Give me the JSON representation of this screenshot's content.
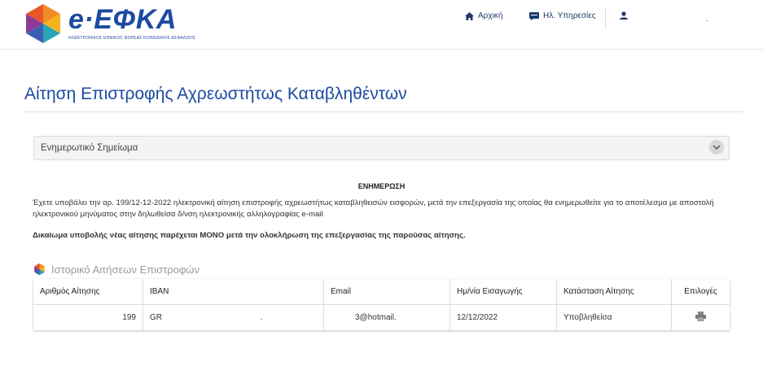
{
  "header": {
    "logo_text": "e·ΕΦΚΑ",
    "logo_subtitle": "ΗΛΕΚΤΡΟΝΙΚΟΣ ΕΘΝΙΚΟΣ ΦΟΡΕΑΣ ΚΟΙΝΩΝΙΚΗΣ ΑΣΦΑΛΙΣΗΣ",
    "nav": [
      {
        "label": "Αρχική",
        "icon": "home-icon"
      },
      {
        "label": "Ηλ. Υπηρεσίες",
        "icon": "chat-icon"
      }
    ],
    "user_icon": "user-icon",
    "user_name": "."
  },
  "page": {
    "title": "Αίτηση Επιστροφής Αχρεωστήτως Καταβληθέντων"
  },
  "accordion": {
    "label": "Ενημερωτικό Σημείωμα",
    "icon": "chevron-down-icon"
  },
  "info": {
    "heading": "ΕΝΗΜΕΡΩΣΗ",
    "text": "Έχετε υποβάλει την αρ. 199/12-12-2022 ηλεκτρονική αίτηση επιστροφής αχρεωστήτως καταβληθεισών εισφορών, μετά την επεξεργασία της οποίας θα ενημερωθείτε για το αποτέλεσμα με αποστολή ηλεκτρονικού μηνύματος στην δηλωθείσα δ/νση ηλεκτρονικής αλληλογραφίας e-mail",
    "bold_text": "Δικαίωμα υποβολής νέας αίτησης παρέχεται ΜΟΝΟ μετά την ολοκλήρωση της επεξεργασίας της παρούσας αίτησης."
  },
  "history": {
    "title": "Ιστορικό Αιτήσεων Επιστροφών",
    "icon": "efka-cube-icon",
    "columns": [
      "Αριθμός Αίτησης",
      "IBAN",
      "Email",
      "Ημ/νία Εισαγωγής",
      "Κατάσταση Αίτησης",
      "Επιλογές"
    ],
    "rows": [
      {
        "number": "199",
        "iban": "GR",
        "iban_tail": ".",
        "email": "3@hotmail.",
        "date": "12/12/2022",
        "status": "Υποβληθείσα",
        "action_icon": "print-icon"
      }
    ]
  },
  "colors": {
    "brand_blue": "#1c4aa1",
    "logo_orange": "#f28c28",
    "logo_purple": "#8e3b97",
    "logo_teal": "#2aa3b8"
  }
}
